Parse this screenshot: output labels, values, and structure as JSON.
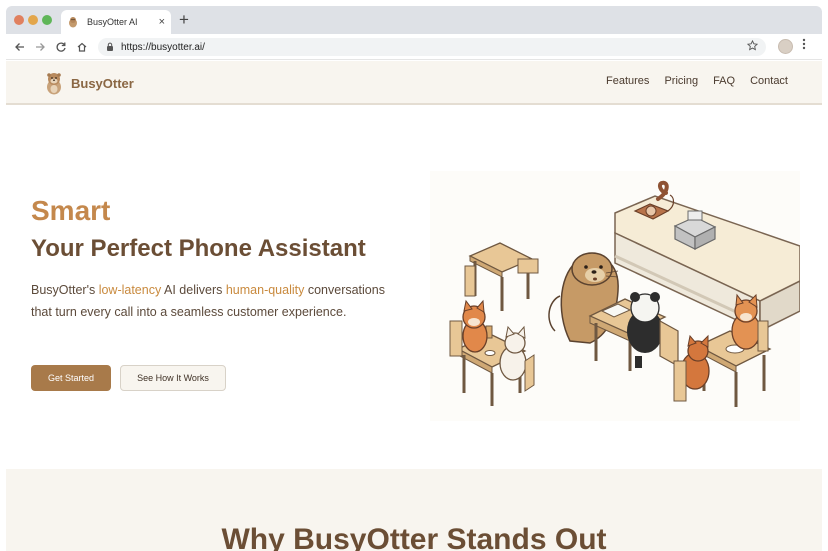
{
  "browser": {
    "tab_title": "BusyOtter AI",
    "tab_close": "×",
    "new_tab": "+",
    "url": "https://busyotter.ai/"
  },
  "header": {
    "brand": "BusyOtter",
    "nav": [
      "Features",
      "Pricing",
      "FAQ",
      "Contact"
    ]
  },
  "hero": {
    "kicker": "Smart",
    "title": "Your Perfect Phone Assistant",
    "desc_part1": "BusyOtter's ",
    "desc_highlight1": "low-latency",
    "desc_part2": " AI delivers ",
    "desc_highlight2": "human-quality",
    "desc_part3": " conversations that turn every call into a seamless customer experience.",
    "cta_primary": "Get Started",
    "cta_secondary": "See How It Works"
  },
  "features": {
    "title": "Why BusyOtter Stands Out"
  },
  "colors": {
    "accent": "#c4884c",
    "brand_dark": "#6b4e35",
    "button": "#a87a4a",
    "header_bg": "#f8f5ef"
  },
  "icons": [
    "back-arrow-icon",
    "forward-arrow-icon",
    "reload-icon",
    "home-icon",
    "lock-icon",
    "star-icon",
    "menu-dots-icon",
    "otter-logo-icon"
  ]
}
